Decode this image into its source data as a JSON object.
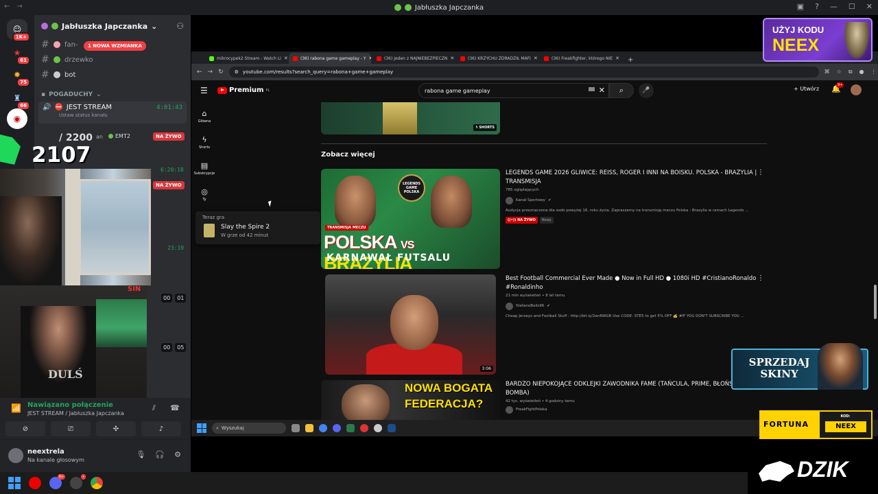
{
  "discord": {
    "window_title": "Jabłuszka Japczanka",
    "server_name": "Jabłuszka Japczanka",
    "rail": {
      "badge_top": "1K+",
      "badge_a": "61",
      "badge_b": "75",
      "badge_c": "66"
    },
    "channels": [
      {
        "name": "fan-"
      },
      {
        "name": "drzewko"
      },
      {
        "name": "bot"
      }
    ],
    "mention_pill": "1 NOWA WZMIANKA",
    "category": "POGADUCHY",
    "voice_channel": {
      "name": "JEST STREAM",
      "timer": "4:01:43",
      "status": "Ustaw status kanału"
    },
    "viewers_a": "2200",
    "viewers_b": "2107",
    "partial_an": "an",
    "tag_emt2": "EMT2",
    "live_label": "NA ŻYWO",
    "timer_2": "6:20:18",
    "timer_3": "23:19",
    "mini_1a": "00",
    "mini_1b": "01",
    "mini_2a": "00",
    "mini_2b": "05",
    "webcam_shirt": "DULŚ",
    "webcam_sign": "SIN",
    "voice_panel": {
      "status": "Nawiązano połączenie",
      "sub": "JEST STREAM / Jabłuszka Japczanka"
    },
    "user_panel": {
      "name": "neextrela",
      "sub": "Na kanale głosowym"
    }
  },
  "browser": {
    "tabs": [
      {
        "title": "mikrocypek2 Stream - Watch Li",
        "color": "#53fc18"
      },
      {
        "title": "(36) rabona game gameplay - Y",
        "color": "#ff0000",
        "active": true
      },
      {
        "title": "(36) Jeden z NAJNIEBEZPIECZN",
        "color": "#ff0000"
      },
      {
        "title": "(36) KRZYCHU ZDRADZIŁ MAFI",
        "color": "#ff0000"
      },
      {
        "title": "(36) Freakfighter, którego NIE",
        "color": "#ff0000"
      }
    ],
    "url": "youtube.com/results?search_query=rabona+game+gameplay"
  },
  "youtube": {
    "logo": "Premium",
    "logo_sup": "PL",
    "search_query": "rabona game gameplay",
    "create_label": "Utwórz",
    "notif_count": "9+",
    "sidebar": [
      {
        "label": "Główna"
      },
      {
        "label": "Shorts"
      },
      {
        "label": "Subskrypcje"
      },
      {
        "label": "Ty"
      }
    ],
    "now_playing": {
      "header": "Teraz gra",
      "game": "Slay the Spire 2",
      "time": "W grze od 42 minut"
    },
    "shorts_badge": "SHORTS",
    "section_title": "Zobacz więcej",
    "videos": [
      {
        "title": "LEGENDS GAME 2026 GLIWICE: REISS, ROGER I INNI NA BOISKU. POLSKA - BRAZYLIA | TRANSMISJA",
        "views": "785 oglądających",
        "channel": "Kanał Sportowy",
        "desc": "Audycja przeznaczona dla osób powyżej 16. roku życia. Zapraszamy na transmisję meczu Polska - Brazylia w ramach Legends ...",
        "badge_live": "NA ŻYWO",
        "badge_new": "Nowy",
        "thumb_text_a": "POLSKA",
        "thumb_text_vs": "VS",
        "thumb_text_b": "BRAZYLIA",
        "thumb_sub": "KARNAWAŁ FUTSALU",
        "thumb_tag": "TRANSMISJA MECZU",
        "thumb_logo": "LEGENDS GAME POLSKA"
      },
      {
        "title": "Best Football Commercial Ever Made ● Now in Full HD ● 1080i HD #CristianoRonaldo #Ronaldinho",
        "views": "21 mln wyświetleń • 8 lat temu",
        "channel": "StefanoBoils96",
        "desc": "Cheap Jerseys and Football Stuff : http://bit.ly/2enRWGR Use CODE: STE5 to get 5% OFF 💰 #IF YOU DON'T SUBSCRIBE YOU ...",
        "duration": "3:06"
      },
      {
        "title": "BARDZO NIEPOKOJĄCE ODKLEJKI ZAWODNIKA FAME (TAŃCULA, PRIME, BŁOŃSKI) BOMBA)",
        "views": "42 tys. wyświetleń • 4 godziny temu",
        "channel": "FreakFightPolska",
        "thumb_text": "NOWA BOGATA FEDERACJA?"
      }
    ]
  },
  "capture_taskbar": {
    "search": "Wyszukaj"
  },
  "overlays": {
    "promo_l1": "UŻYJ KODU",
    "promo_l2": "NEEX",
    "skiny": "SPRZEDAJ SKINY",
    "fortuna": "FORTUNA",
    "fortuna_code_label": "KOD:",
    "fortuna_code": "NEEX",
    "dzik": "DZIK"
  },
  "colors": {
    "discord_bg": "#2b2d31",
    "youtube_bg": "#0f0f0f",
    "live_red": "#da373c",
    "connected_green": "#23a55a"
  }
}
